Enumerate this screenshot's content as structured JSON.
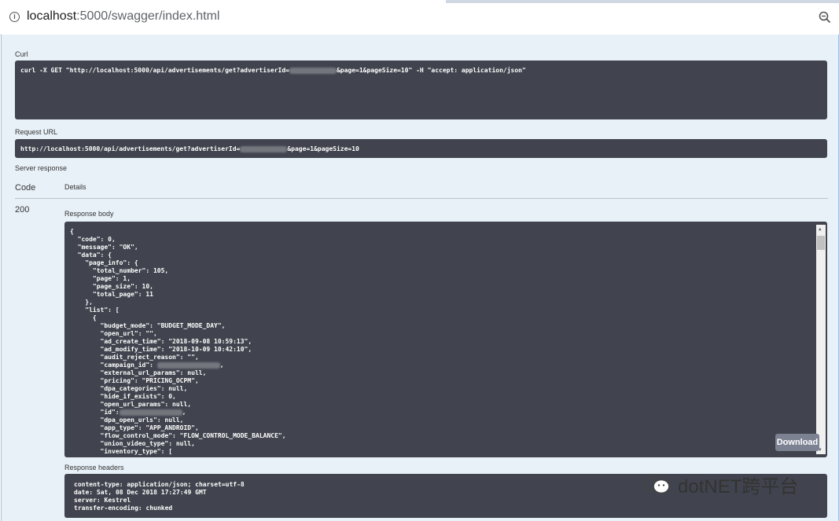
{
  "browser": {
    "url_host": "localhost",
    "url_path": ":5000/swagger/index.html"
  },
  "curl": {
    "label": "Curl",
    "cmd_prefix": "curl -X GET \"http://localhost:5000/api/advertisements/get?advertiserId=",
    "cmd_suffix": "&page=1&pageSize=10\" -H \"accept: application/json\""
  },
  "request_url": {
    "label": "Request URL",
    "prefix": "http://localhost:5000/api/advertisements/get?advertiserId=",
    "suffix": "&page=1&pageSize=10"
  },
  "server_response": {
    "label": "Server response",
    "col_code": "Code",
    "col_details": "Details",
    "code": "200",
    "body_label": "Response body",
    "body_lines": [
      "{",
      "  \"code\": 0,",
      "  \"message\": \"OK\",",
      "  \"data\": {",
      "    \"page_info\": {",
      "      \"total_number\": 105,",
      "      \"page\": 1,",
      "      \"page_size\": 10,",
      "      \"total_page\": 11",
      "    },",
      "    \"list\": [",
      "      {",
      "        \"budget_mode\": \"BUDGET_MODE_DAY\",",
      "        \"open_url\": \"\",",
      "        \"ad_create_time\": \"2018-09-08 10:59:13\",",
      "        \"ad_modify_time\": \"2018-10-09 10:42:10\",",
      "        \"audit_reject_reason\": \"\",",
      "        \"campaign_id\": ",
      "        \"external_url_params\": null,",
      "        \"pricing\": \"PRICING_OCPM\",",
      "        \"dpa_categories\": null,",
      "        \"hide_if_exists\": 0,",
      "        \"open_url_params\": null,",
      "        \"id\":",
      "        \"dpa_open_urls\": null,",
      "        \"app_type\": \"APP_ANDROID\",",
      "        \"flow_control_mode\": \"FLOW_CONTROL_MODE_BALANCE\",",
      "        \"union_video_type\": null,",
      "        \"inventory_type\": ["
    ],
    "download_label": "Download",
    "headers_label": "Response headers",
    "header_lines": [
      "content-type: application/json; charset=utf-8",
      "date: Sat, 08 Dec 2018 17:27:49 GMT",
      "server: Kestrel",
      "transfer-encoding: chunked"
    ]
  },
  "watermark": {
    "text": "dotNET跨平台"
  }
}
